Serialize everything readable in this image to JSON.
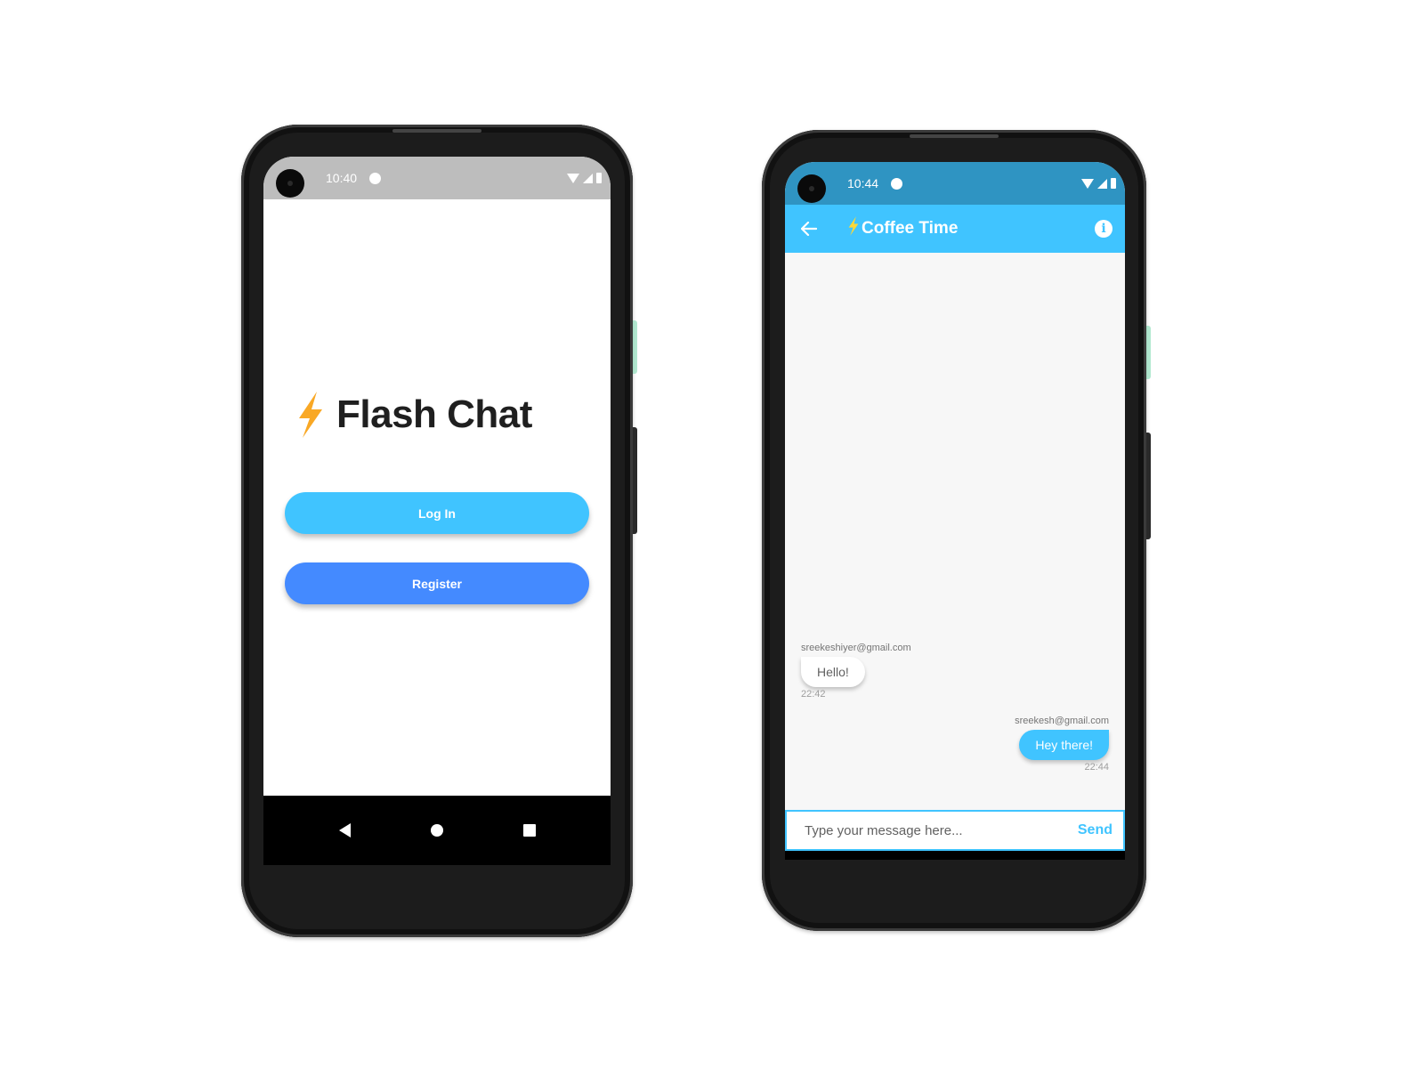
{
  "login_screen": {
    "status_bar": {
      "time": "10:40"
    },
    "title": "Flash Chat",
    "login_label": "Log In",
    "register_label": "Register",
    "colors": {
      "login": "#40c4ff",
      "register": "#448aff",
      "bolt": "#f9a825"
    }
  },
  "chat_screen": {
    "status_bar": {
      "time": "10:44"
    },
    "appbar": {
      "title": "Coffee Time",
      "info_icon": "info-icon",
      "back_icon": "back-arrow-icon"
    },
    "messages": [
      {
        "sender": "sreekeshiyer@gmail.com",
        "text": "Hello!",
        "time": "22:42",
        "is_me": false
      },
      {
        "sender": "sreekesh@gmail.com",
        "text": "Hey there!",
        "time": "22:44",
        "is_me": true
      }
    ],
    "composer": {
      "placeholder": "Type your message here...",
      "value": "",
      "send_label": "Send"
    },
    "colors": {
      "accent": "#40c4ff",
      "status_bar": "#2f94c2",
      "chat_bg": "#f7f7f7"
    }
  },
  "nav_icons": [
    "back-triangle-icon",
    "home-circle-icon",
    "recents-square-icon"
  ]
}
